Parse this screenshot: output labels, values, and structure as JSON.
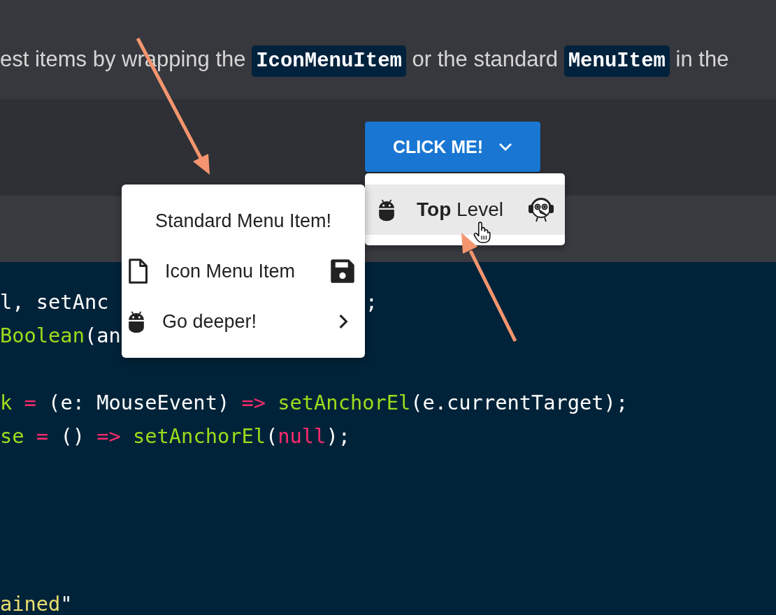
{
  "description": [
    {
      "kind": "plain",
      "text": "est items by wrapping the "
    },
    {
      "kind": "code",
      "text": "IconMenuItem"
    },
    {
      "kind": "plain",
      "text": " or the standard "
    },
    {
      "kind": "code",
      "text": "MenuItem"
    },
    {
      "kind": "plain",
      "text": " in the"
    }
  ],
  "button": {
    "label": "CLICK ME!"
  },
  "top_menu": {
    "items": [
      {
        "label": "**Top** Level",
        "highlighted": true
      }
    ]
  },
  "nested_menu": {
    "items": [
      {
        "kind": "text",
        "label": "Standard Menu Item!"
      },
      {
        "kind": "icon",
        "label": "Icon Menu Item"
      },
      {
        "kind": "submenu",
        "label": "Go deeper!"
      }
    ]
  },
  "code_lines": [
    {
      "kind": "code",
      "tokens": [
        {
          "kind": "plain",
          "text": "l, setAnc"
        },
        {
          "kind": "tail",
          "text": ";"
        }
      ]
    },
    {
      "kind": "code",
      "tokens": [
        {
          "kind": "fn",
          "text": "Boolean"
        },
        {
          "kind": "plain",
          "text": "(an"
        }
      ]
    },
    {
      "kind": "blank"
    },
    {
      "kind": "code",
      "tokens": [
        {
          "kind": "fn",
          "text": "k"
        },
        {
          "kind": "op",
          "text": " = "
        },
        {
          "kind": "plain",
          "text": "(e: MouseEvent) "
        },
        {
          "kind": "op",
          "text": "=>"
        },
        {
          "kind": "fn",
          "text": " setAnchorEl"
        },
        {
          "kind": "plain",
          "text": "(e.currentTarget);"
        }
      ]
    },
    {
      "kind": "code",
      "tokens": [
        {
          "kind": "fn",
          "text": "se"
        },
        {
          "kind": "op",
          "text": " = "
        },
        {
          "kind": "plain",
          "text": "() "
        },
        {
          "kind": "op",
          "text": "=>"
        },
        {
          "kind": "fn",
          "text": " setAnchorEl"
        },
        {
          "kind": "plain",
          "text": "("
        },
        {
          "kind": "keyword",
          "text": "null"
        },
        {
          "kind": "plain",
          "text": ");"
        }
      ]
    },
    {
      "kind": "blank"
    },
    {
      "kind": "blank"
    },
    {
      "kind": "blank"
    },
    {
      "kind": "blank"
    },
    {
      "kind": "code",
      "tokens": [
        {
          "kind": "string",
          "text": "ained"
        },
        {
          "kind": "plain",
          "text": "\""
        }
      ]
    }
  ]
}
